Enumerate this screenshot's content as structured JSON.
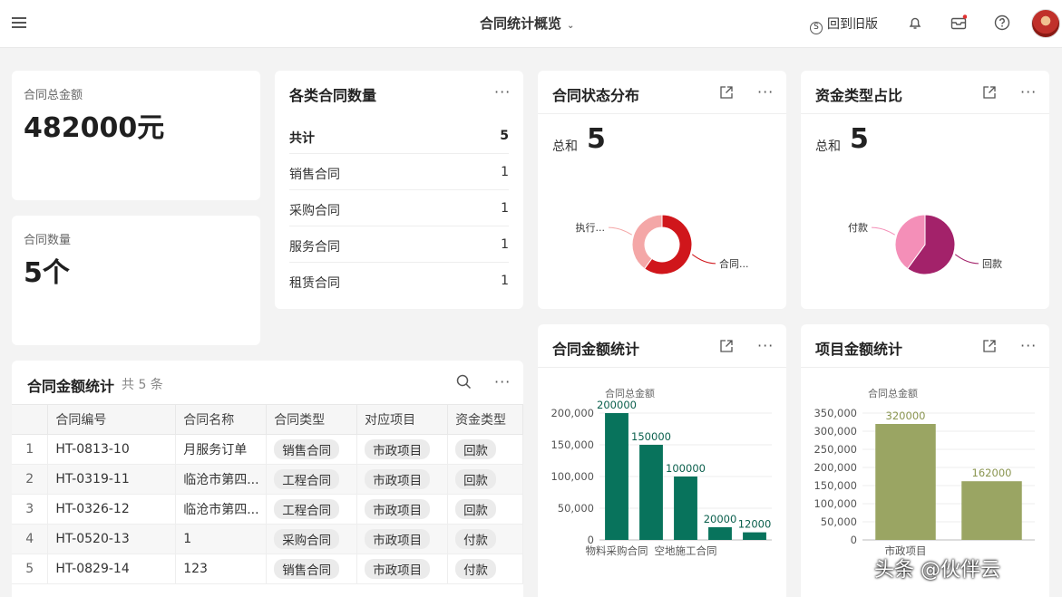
{
  "header": {
    "title": "合同统计概览",
    "old_version": "回到旧版"
  },
  "kpi_total": {
    "label": "合同总金额",
    "value": "482000元"
  },
  "kpi_count": {
    "label": "合同数量",
    "value": "5个"
  },
  "contract_types": {
    "title": "各类合同数量",
    "rows": [
      {
        "label": "共计",
        "value": "5"
      },
      {
        "label": "销售合同",
        "value": "1"
      },
      {
        "label": "采购合同",
        "value": "1"
      },
      {
        "label": "服务合同",
        "value": "1"
      },
      {
        "label": "租赁合同",
        "value": "1"
      }
    ]
  },
  "status_card": {
    "title": "合同状态分布",
    "sum_label": "总和",
    "sum_value": "5"
  },
  "fund_card": {
    "title": "资金类型占比",
    "sum_label": "总和",
    "sum_value": "5"
  },
  "table": {
    "title": "合同金额统计",
    "count": "共 5 条",
    "columns": [
      "",
      "合同编号",
      "合同名称",
      "合同类型",
      "对应项目",
      "资金类型"
    ],
    "rows": [
      [
        "1",
        "HT-0813-10",
        "月服务订单",
        "销售合同",
        "市政项目",
        "回款"
      ],
      [
        "2",
        "HT-0319-11",
        "临沧市第四...",
        "工程合同",
        "市政项目",
        "回款"
      ],
      [
        "3",
        "HT-0326-12",
        "临沧市第四...",
        "工程合同",
        "市政项目",
        "回款"
      ],
      [
        "4",
        "HT-0520-13",
        "1",
        "采购合同",
        "市政项目",
        "付款"
      ],
      [
        "5",
        "HT-0829-14",
        "123",
        "销售合同",
        "市政项目",
        "付款"
      ]
    ]
  },
  "amount_card": {
    "title": "合同金额统计"
  },
  "project_card": {
    "title": "项目金额统计"
  },
  "watermark": "头条 @伙伴云",
  "chart_data": [
    {
      "type": "pie",
      "subtype": "donut",
      "labels": [
        "执行...",
        "合同..."
      ],
      "values": [
        2,
        3
      ],
      "colors": [
        "#f4a7a7",
        "#d0161b"
      ]
    },
    {
      "type": "pie",
      "labels": [
        "付款",
        "回款"
      ],
      "values": [
        2,
        3
      ],
      "colors": [
        "#f48fb8",
        "#a3226a"
      ]
    },
    {
      "type": "bar",
      "legend": "合同总金额",
      "categories": [
        "物料采购合同",
        "",
        "空地施工合同",
        "",
        ""
      ],
      "values": [
        200000,
        150000,
        100000,
        20000,
        12000
      ],
      "ylim": [
        0,
        200000
      ],
      "yticks": [
        "0",
        "50,000",
        "100,000",
        "150,000",
        "200,000"
      ],
      "color": "#08735c",
      "label_color": "#0a5f4c"
    },
    {
      "type": "bar",
      "legend": "合同总金额",
      "categories": [
        "市政项目",
        ""
      ],
      "values": [
        320000,
        162000
      ],
      "ylim": [
        0,
        350000
      ],
      "yticks": [
        "0",
        "50,000",
        "100,000",
        "150,000",
        "200,000",
        "250,000",
        "300,000",
        "350,000"
      ],
      "color": "#9aa563",
      "label_color": "#8a9550"
    }
  ]
}
